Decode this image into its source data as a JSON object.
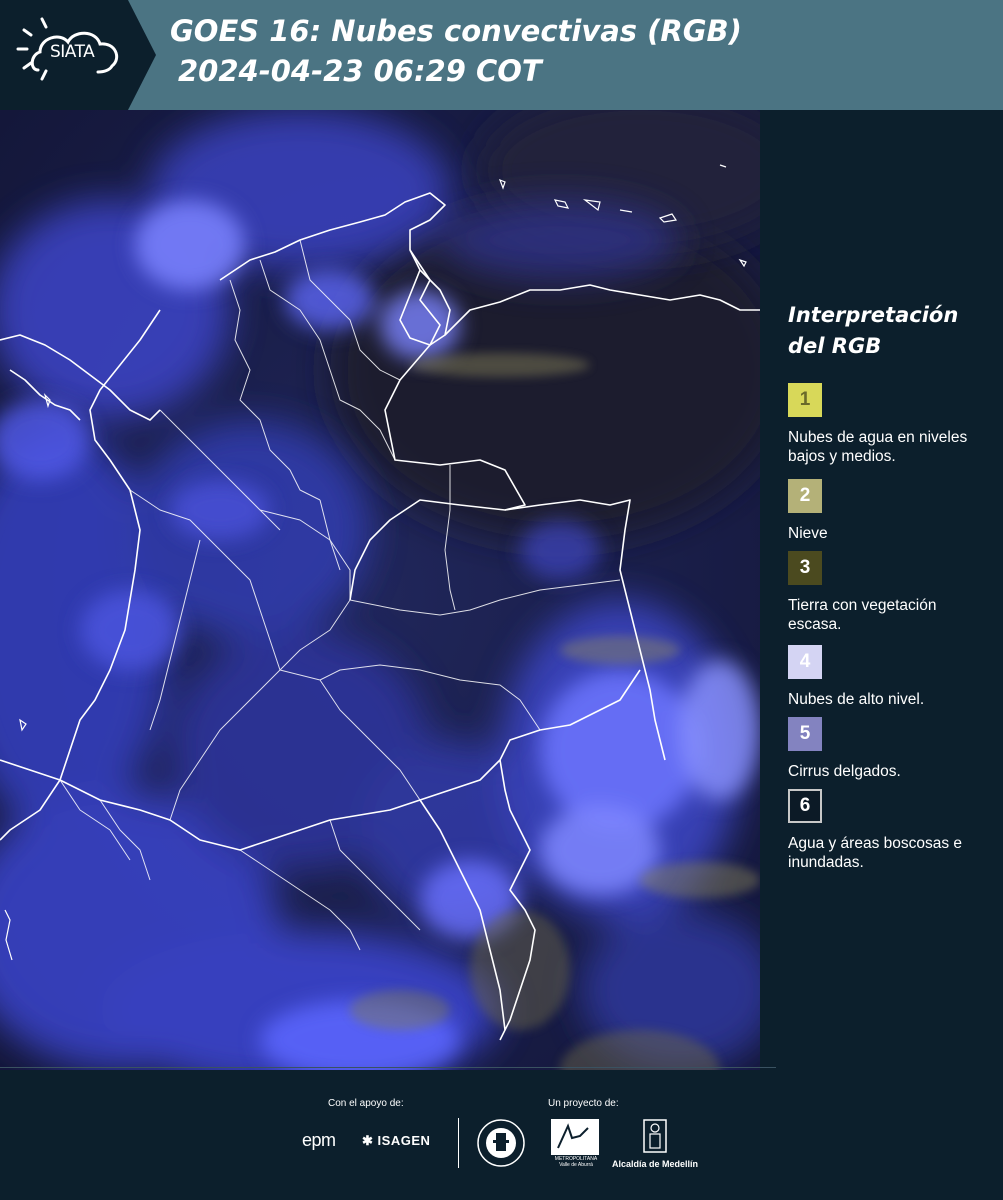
{
  "header": {
    "logo_text": "SIATA",
    "title_line1": "GOES 16: Nubes convectivas (RGB)",
    "title_line2": "2024-04-23 06:29 COT",
    "background_color": "#4b7483",
    "logo_background_color": "#0c1f2c"
  },
  "legend": {
    "title": "Interpretación del RGB",
    "items": [
      {
        "number": "1",
        "label": "Nubes de agua en niveles bajos y medios.",
        "color": "#d8d859"
      },
      {
        "number": "2",
        "label": "Nieve",
        "color": "#b4b178"
      },
      {
        "number": "3",
        "label": "Tierra con vegetación escasa.",
        "color": "#4b4a1f"
      },
      {
        "number": "4",
        "label": "Nubes de alto nivel.",
        "color": "#d4d4f3"
      },
      {
        "number": "5",
        "label": "Cirrus delgados.",
        "color": "#8383c0"
      },
      {
        "number": "6",
        "label": "Agua y áreas boscosas e inundadas.",
        "color": "#0c1a26"
      }
    ]
  },
  "footer": {
    "support_label": "Con el apoyo de:",
    "project_label": "Un proyecto de:",
    "epm_text": "epm",
    "isagen_text": "ISAGEN",
    "area_logo_lines": "METROPOLITANA Valle de Aburrá",
    "alcaldia_text": "Alcaldía de Medellín"
  },
  "map": {
    "background_color": "#1a1f4a",
    "cloud_color": "#4b55e6",
    "border_color": "#ffffff"
  }
}
